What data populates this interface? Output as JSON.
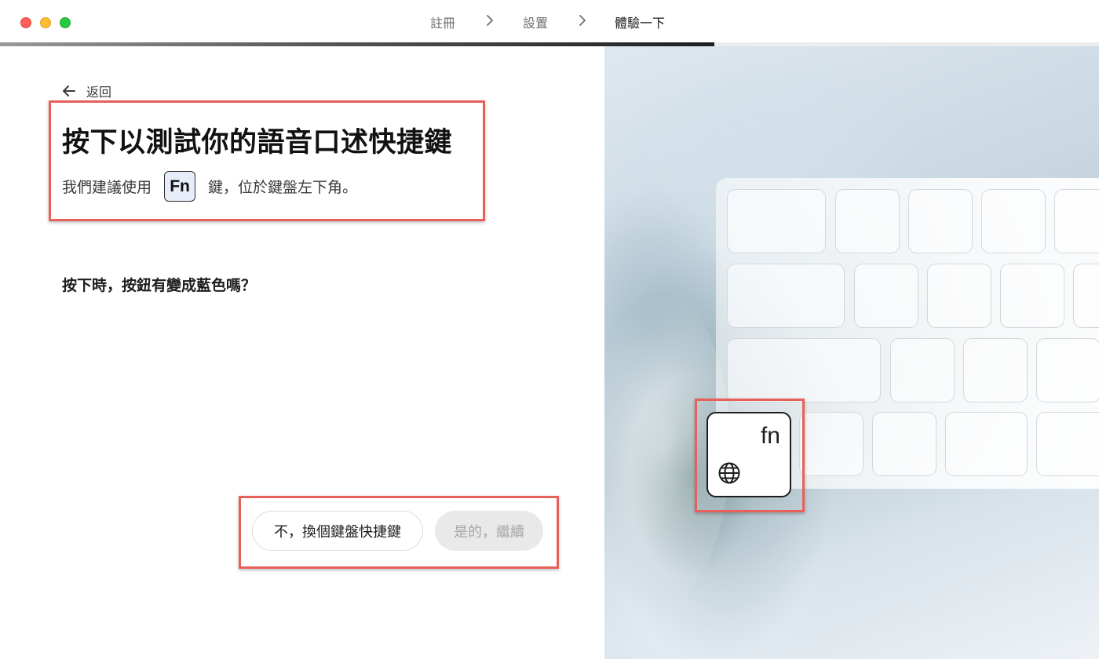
{
  "window": {
    "steps": [
      {
        "label": "註冊",
        "active": false
      },
      {
        "label": "設置",
        "active": false
      },
      {
        "label": "體驗一下",
        "active": true
      }
    ],
    "progress": 0.65
  },
  "left_panel": {
    "back_label": "返回",
    "title": "按下以測試你的語音口述快捷鍵",
    "subtitle_before": "我們建議使用",
    "key_chip": "Fn",
    "subtitle_after": "鍵，位於鍵盤左下角。",
    "question": "按下時，按鈕有變成藍色嗎？",
    "buttons": {
      "no_label": "不，換個鍵盤快捷鍵",
      "yes_label": "是的，繼續"
    }
  },
  "right_panel": {
    "fn_key_label": "fn",
    "fn_key_icon": "globe-icon"
  },
  "colors": {
    "highlight_box": "#e8605a",
    "traffic_close": "#fe5f57",
    "traffic_minimize": "#febc2e",
    "traffic_maximize": "#28c840",
    "key_chip_bg": "#e7edf8"
  }
}
